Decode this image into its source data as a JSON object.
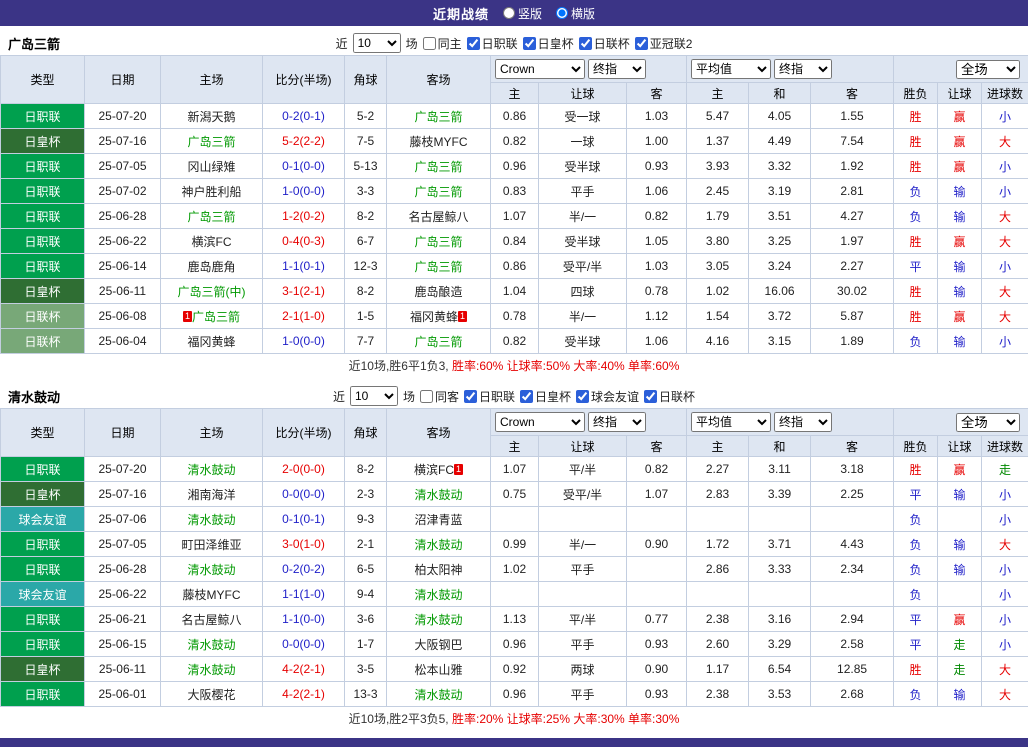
{
  "top_bar": {
    "title": "近期战绩",
    "layout_options": [
      {
        "label": "竖版",
        "selected": false
      },
      {
        "label": "横版",
        "selected": true
      }
    ]
  },
  "colors": {
    "red": "#E60000",
    "blue": "#1E1EC8",
    "green": "#008800",
    "team": "#009900",
    "black": "#222222",
    "jleague": "#00A04E",
    "emperor": "#2F6E33",
    "levain": "#78A878",
    "friendly": "#2BA8A8",
    "accent_purple": "#3B3486",
    "header_bg": "#DEE6F2"
  },
  "table_header": {
    "type": "类型",
    "date": "日期",
    "home": "主场",
    "score": "比分(半场)",
    "corner": "角球",
    "away": "客场",
    "bookmaker": "Crown",
    "ah_time": "终指",
    "eu_avg": "平均值",
    "eu_time": "终指",
    "scope": "全场",
    "ah_home": "主",
    "ah_line": "让球",
    "ah_away": "客",
    "eu_home": "主",
    "eu_draw": "和",
    "eu_away": "客",
    "wdl": "胜负",
    "ah_result": "让球",
    "goals": "进球数"
  },
  "sections": [
    {
      "team": "广岛三箭",
      "filter": {
        "near": "近",
        "count": "10",
        "games": "场",
        "same": {
          "label": "同主",
          "checked": false
        },
        "leagues": [
          {
            "label": "日职联",
            "checked": true
          },
          {
            "label": "日皇杯",
            "checked": true
          },
          {
            "label": "日联杯",
            "checked": true
          },
          {
            "label": "亚冠联2",
            "checked": true
          }
        ]
      },
      "rows": [
        {
          "type": "日职联",
          "type_bg": "jleague",
          "date": "25-07-20",
          "home": "新潟天鹅",
          "home_color": "black",
          "home_pre": "",
          "home_post": "",
          "score": "0-2(0-1)",
          "score_color": "blue",
          "corner": "5-2",
          "away": "广岛三箭",
          "away_color": "team",
          "away_pre": "",
          "away_post": "",
          "ah_home": "0.86",
          "ah_line": "受一球",
          "ah_away": "1.03",
          "eu_home": "5.47",
          "eu_draw": "4.05",
          "eu_away": "1.55",
          "wdl": "胜",
          "wdl_color": "red",
          "ahr": "赢",
          "ahr_color": "red",
          "ou": "小",
          "ou_color": "blue"
        },
        {
          "type": "日皇杯",
          "type_bg": "emperor",
          "date": "25-07-16",
          "home": "广岛三箭",
          "home_color": "team",
          "home_pre": "",
          "home_post": "",
          "score": "5-2(2-2)",
          "score_color": "red",
          "corner": "7-5",
          "away": "藤枝MYFC",
          "away_color": "black",
          "away_pre": "",
          "away_post": "",
          "ah_home": "0.82",
          "ah_line": "一球",
          "ah_away": "1.00",
          "eu_home": "1.37",
          "eu_draw": "4.49",
          "eu_away": "7.54",
          "wdl": "胜",
          "wdl_color": "red",
          "ahr": "赢",
          "ahr_color": "red",
          "ou": "大",
          "ou_color": "red"
        },
        {
          "type": "日职联",
          "type_bg": "jleague",
          "date": "25-07-05",
          "home": "冈山绿雉",
          "home_color": "black",
          "home_pre": "",
          "home_post": "",
          "score": "0-1(0-0)",
          "score_color": "blue",
          "corner": "5-13",
          "away": "广岛三箭",
          "away_color": "team",
          "away_pre": "",
          "away_post": "",
          "ah_home": "0.96",
          "ah_line": "受半球",
          "ah_away": "0.93",
          "eu_home": "3.93",
          "eu_draw": "3.32",
          "eu_away": "1.92",
          "wdl": "胜",
          "wdl_color": "red",
          "ahr": "赢",
          "ahr_color": "red",
          "ou": "小",
          "ou_color": "blue"
        },
        {
          "type": "日职联",
          "type_bg": "jleague",
          "date": "25-07-02",
          "home": "神户胜利船",
          "home_color": "black",
          "home_pre": "",
          "home_post": "",
          "score": "1-0(0-0)",
          "score_color": "blue",
          "corner": "3-3",
          "away": "广岛三箭",
          "away_color": "team",
          "away_pre": "",
          "away_post": "",
          "ah_home": "0.83",
          "ah_line": "平手",
          "ah_away": "1.06",
          "eu_home": "2.45",
          "eu_draw": "3.19",
          "eu_away": "2.81",
          "wdl": "负",
          "wdl_color": "blue",
          "ahr": "输",
          "ahr_color": "blue",
          "ou": "小",
          "ou_color": "blue"
        },
        {
          "type": "日职联",
          "type_bg": "jleague",
          "date": "25-06-28",
          "home": "广岛三箭",
          "home_color": "team",
          "home_pre": "",
          "home_post": "",
          "score": "1-2(0-2)",
          "score_color": "red",
          "corner": "8-2",
          "away": "名古屋鲸八",
          "away_color": "black",
          "away_pre": "",
          "away_post": "",
          "ah_home": "1.07",
          "ah_line": "半/一",
          "ah_away": "0.82",
          "eu_home": "1.79",
          "eu_draw": "3.51",
          "eu_away": "4.27",
          "wdl": "负",
          "wdl_color": "blue",
          "ahr": "输",
          "ahr_color": "blue",
          "ou": "大",
          "ou_color": "red"
        },
        {
          "type": "日职联",
          "type_bg": "jleague",
          "date": "25-06-22",
          "home": "横滨FC",
          "home_color": "black",
          "home_pre": "",
          "home_post": "",
          "score": "0-4(0-3)",
          "score_color": "red",
          "corner": "6-7",
          "away": "广岛三箭",
          "away_color": "team",
          "away_pre": "",
          "away_post": "",
          "ah_home": "0.84",
          "ah_line": "受半球",
          "ah_away": "1.05",
          "eu_home": "3.80",
          "eu_draw": "3.25",
          "eu_away": "1.97",
          "wdl": "胜",
          "wdl_color": "red",
          "ahr": "赢",
          "ahr_color": "red",
          "ou": "大",
          "ou_color": "red"
        },
        {
          "type": "日职联",
          "type_bg": "jleague",
          "date": "25-06-14",
          "home": "鹿岛鹿角",
          "home_color": "black",
          "home_pre": "",
          "home_post": "",
          "score": "1-1(0-1)",
          "score_color": "blue",
          "corner": "12-3",
          "away": "广岛三箭",
          "away_color": "team",
          "away_pre": "",
          "away_post": "",
          "ah_home": "0.86",
          "ah_line": "受平/半",
          "ah_away": "1.03",
          "eu_home": "3.05",
          "eu_draw": "3.24",
          "eu_away": "2.27",
          "wdl": "平",
          "wdl_color": "blue",
          "ahr": "输",
          "ahr_color": "blue",
          "ou": "小",
          "ou_color": "blue"
        },
        {
          "type": "日皇杯",
          "type_bg": "emperor",
          "date": "25-06-11",
          "home": "广岛三箭(中)",
          "home_color": "team",
          "home_pre": "",
          "home_post": "",
          "score": "3-1(2-1)",
          "score_color": "red",
          "corner": "8-2",
          "away": "鹿岛酿造",
          "away_color": "black",
          "away_pre": "",
          "away_post": "",
          "ah_home": "1.04",
          "ah_line": "四球",
          "ah_away": "0.78",
          "eu_home": "1.02",
          "eu_draw": "16.06",
          "eu_away": "30.02",
          "wdl": "胜",
          "wdl_color": "red",
          "ahr": "输",
          "ahr_color": "blue",
          "ou": "大",
          "ou_color": "red"
        },
        {
          "type": "日联杯",
          "type_bg": "levain",
          "date": "25-06-08",
          "home": "广岛三箭",
          "home_color": "team",
          "home_pre": "1",
          "home_post": "",
          "score": "2-1(1-0)",
          "score_color": "red",
          "corner": "1-5",
          "away": "福冈黄蜂",
          "away_color": "black",
          "away_pre": "",
          "away_post": "1",
          "ah_home": "0.78",
          "ah_line": "半/一",
          "ah_away": "1.12",
          "eu_home": "1.54",
          "eu_draw": "3.72",
          "eu_away": "5.87",
          "wdl": "胜",
          "wdl_color": "red",
          "ahr": "赢",
          "ahr_color": "red",
          "ou": "大",
          "ou_color": "red"
        },
        {
          "type": "日联杯",
          "type_bg": "levain",
          "date": "25-06-04",
          "home": "福冈黄蜂",
          "home_color": "black",
          "home_pre": "",
          "home_post": "",
          "score": "1-0(0-0)",
          "score_color": "blue",
          "corner": "7-7",
          "away": "广岛三箭",
          "away_color": "team",
          "away_pre": "",
          "away_post": "",
          "ah_home": "0.82",
          "ah_line": "受半球",
          "ah_away": "1.06",
          "eu_home": "4.16",
          "eu_draw": "3.15",
          "eu_away": "1.89",
          "wdl": "负",
          "wdl_color": "blue",
          "ahr": "输",
          "ahr_color": "blue",
          "ou": "小",
          "ou_color": "blue"
        }
      ],
      "summary": {
        "record": "近10场,胜6平1负3,",
        "stats": "胜率:60% 让球率:50% 大率:40% 单率:60%"
      }
    },
    {
      "team": "清水鼓动",
      "filter": {
        "near": "近",
        "count": "10",
        "games": "场",
        "same": {
          "label": "同客",
          "checked": false
        },
        "leagues": [
          {
            "label": "日职联",
            "checked": true
          },
          {
            "label": "日皇杯",
            "checked": true
          },
          {
            "label": "球会友谊",
            "checked": true
          },
          {
            "label": "日联杯",
            "checked": true
          }
        ]
      },
      "rows": [
        {
          "type": "日职联",
          "type_bg": "jleague",
          "date": "25-07-20",
          "home": "清水鼓动",
          "home_color": "team",
          "home_pre": "",
          "home_post": "",
          "score": "2-0(0-0)",
          "score_color": "red",
          "corner": "8-2",
          "away": "横滨FC",
          "away_color": "black",
          "away_pre": "",
          "away_post": "1",
          "ah_home": "1.07",
          "ah_line": "平/半",
          "ah_away": "0.82",
          "eu_home": "2.27",
          "eu_draw": "3.11",
          "eu_away": "3.18",
          "wdl": "胜",
          "wdl_color": "red",
          "ahr": "赢",
          "ahr_color": "red",
          "ou": "走",
          "ou_color": "green"
        },
        {
          "type": "日皇杯",
          "type_bg": "emperor",
          "date": "25-07-16",
          "home": "湘南海洋",
          "home_color": "black",
          "home_pre": "",
          "home_post": "",
          "score": "0-0(0-0)",
          "score_color": "blue",
          "corner": "2-3",
          "away": "清水鼓动",
          "away_color": "team",
          "away_pre": "",
          "away_post": "",
          "ah_home": "0.75",
          "ah_line": "受平/半",
          "ah_away": "1.07",
          "eu_home": "2.83",
          "eu_draw": "3.39",
          "eu_away": "2.25",
          "wdl": "平",
          "wdl_color": "blue",
          "ahr": "输",
          "ahr_color": "blue",
          "ou": "小",
          "ou_color": "blue"
        },
        {
          "type": "球会友谊",
          "type_bg": "friendly",
          "date": "25-07-06",
          "home": "清水鼓动",
          "home_color": "team",
          "home_pre": "",
          "home_post": "",
          "score": "0-1(0-1)",
          "score_color": "blue",
          "corner": "9-3",
          "away": "沼津青蓝",
          "away_color": "black",
          "away_pre": "",
          "away_post": "",
          "ah_home": "",
          "ah_line": "",
          "ah_away": "",
          "eu_home": "",
          "eu_draw": "",
          "eu_away": "",
          "wdl": "负",
          "wdl_color": "blue",
          "ahr": "",
          "ahr_color": "blue",
          "ou": "小",
          "ou_color": "blue"
        },
        {
          "type": "日职联",
          "type_bg": "jleague",
          "date": "25-07-05",
          "home": "町田泽维亚",
          "home_color": "black",
          "home_pre": "",
          "home_post": "",
          "score": "3-0(1-0)",
          "score_color": "red",
          "corner": "2-1",
          "away": "清水鼓动",
          "away_color": "team",
          "away_pre": "",
          "away_post": "",
          "ah_home": "0.99",
          "ah_line": "半/一",
          "ah_away": "0.90",
          "eu_home": "1.72",
          "eu_draw": "3.71",
          "eu_away": "4.43",
          "wdl": "负",
          "wdl_color": "blue",
          "ahr": "输",
          "ahr_color": "blue",
          "ou": "大",
          "ou_color": "red"
        },
        {
          "type": "日职联",
          "type_bg": "jleague",
          "date": "25-06-28",
          "home": "清水鼓动",
          "home_color": "team",
          "home_pre": "",
          "home_post": "",
          "score": "0-2(0-2)",
          "score_color": "blue",
          "corner": "6-5",
          "away": "柏太阳神",
          "away_color": "black",
          "away_pre": "",
          "away_post": "",
          "ah_home": "1.02",
          "ah_line": "平手",
          "ah_away": "",
          "eu_home": "2.86",
          "eu_draw": "3.33",
          "eu_away": "2.34",
          "wdl": "负",
          "wdl_color": "blue",
          "ahr": "输",
          "ahr_color": "blue",
          "ou": "小",
          "ou_color": "blue"
        },
        {
          "type": "球会友谊",
          "type_bg": "friendly",
          "date": "25-06-22",
          "home": "藤枝MYFC",
          "home_color": "black",
          "home_pre": "",
          "home_post": "",
          "score": "1-1(1-0)",
          "score_color": "blue",
          "corner": "9-4",
          "away": "清水鼓动",
          "away_color": "team",
          "away_pre": "",
          "away_post": "",
          "ah_home": "",
          "ah_line": "",
          "ah_away": "",
          "eu_home": "",
          "eu_draw": "",
          "eu_away": "",
          "wdl": "负",
          "wdl_color": "blue",
          "ahr": "",
          "ahr_color": "blue",
          "ou": "小",
          "ou_color": "blue"
        },
        {
          "type": "日职联",
          "type_bg": "jleague",
          "date": "25-06-21",
          "home": "名古屋鲸八",
          "home_color": "black",
          "home_pre": "",
          "home_post": "",
          "score": "1-1(0-0)",
          "score_color": "blue",
          "corner": "3-6",
          "away": "清水鼓动",
          "away_color": "team",
          "away_pre": "",
          "away_post": "",
          "ah_home": "1.13",
          "ah_line": "平/半",
          "ah_away": "0.77",
          "eu_home": "2.38",
          "eu_draw": "3.16",
          "eu_away": "2.94",
          "wdl": "平",
          "wdl_color": "blue",
          "ahr": "赢",
          "ahr_color": "red",
          "ou": "小",
          "ou_color": "blue"
        },
        {
          "type": "日职联",
          "type_bg": "jleague",
          "date": "25-06-15",
          "home": "清水鼓动",
          "home_color": "team",
          "home_pre": "",
          "home_post": "",
          "score": "0-0(0-0)",
          "score_color": "blue",
          "corner": "1-7",
          "away": "大阪钢巴",
          "away_color": "black",
          "away_pre": "",
          "away_post": "",
          "ah_home": "0.96",
          "ah_line": "平手",
          "ah_away": "0.93",
          "eu_home": "2.60",
          "eu_draw": "3.29",
          "eu_away": "2.58",
          "wdl": "平",
          "wdl_color": "blue",
          "ahr": "走",
          "ahr_color": "green",
          "ou": "小",
          "ou_color": "blue"
        },
        {
          "type": "日皇杯",
          "type_bg": "emperor",
          "date": "25-06-11",
          "home": "清水鼓动",
          "home_color": "team",
          "home_pre": "",
          "home_post": "",
          "score": "4-2(2-1)",
          "score_color": "red",
          "corner": "3-5",
          "away": "松本山雅",
          "away_color": "black",
          "away_pre": "",
          "away_post": "",
          "ah_home": "0.92",
          "ah_line": "两球",
          "ah_away": "0.90",
          "eu_home": "1.17",
          "eu_draw": "6.54",
          "eu_away": "12.85",
          "wdl": "胜",
          "wdl_color": "red",
          "ahr": "走",
          "ahr_color": "green",
          "ou": "大",
          "ou_color": "red"
        },
        {
          "type": "日职联",
          "type_bg": "jleague",
          "date": "25-06-01",
          "home": "大阪樱花",
          "home_color": "black",
          "home_pre": "",
          "home_post": "",
          "score": "4-2(2-1)",
          "score_color": "red",
          "corner": "13-3",
          "away": "清水鼓动",
          "away_color": "team",
          "away_pre": "",
          "away_post": "",
          "ah_home": "0.96",
          "ah_line": "平手",
          "ah_away": "0.93",
          "eu_home": "2.38",
          "eu_draw": "3.53",
          "eu_away": "2.68",
          "wdl": "负",
          "wdl_color": "blue",
          "ahr": "输",
          "ahr_color": "blue",
          "ou": "大",
          "ou_color": "red"
        }
      ],
      "summary": {
        "record": "近10场,胜2平3负5,",
        "stats": "胜率:20% 让球率:25% 大率:30% 单率:30%"
      }
    }
  ]
}
